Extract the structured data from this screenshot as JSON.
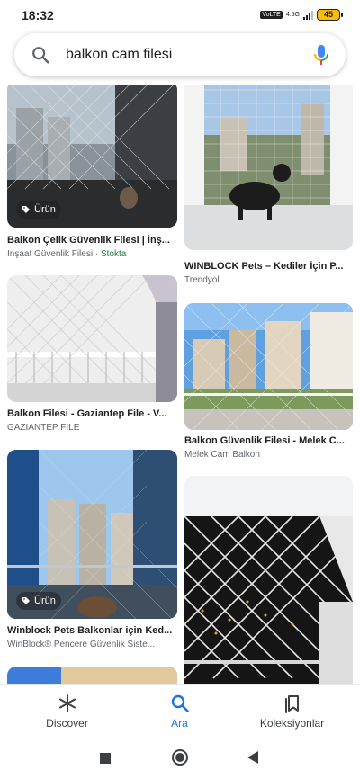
{
  "status": {
    "time": "18:32",
    "volte": "VoLTE",
    "network": "4.5G",
    "battery": "45"
  },
  "search": {
    "query": "balkon cam filesi"
  },
  "results": [
    {
      "title": "Balkon Çelik Güvenlik Filesi | İnş...",
      "source": "İnşaat Güvenlik Filesi",
      "separator": " · ",
      "stock": "Stokta",
      "chip": "Ürün"
    },
    {
      "title": "WINBLOCK Pets – Kediler İçin P...",
      "source": "Trendyol"
    },
    {
      "title": "Balkon Filesi - Gaziantep File - V...",
      "source": "GAZİANTEP FİLE"
    },
    {
      "title": "Balkon Güvenlik Filesi - Melek C...",
      "source": "Melek Cam Balkon"
    },
    {
      "title": "Winblock Pets Balkonlar için Ked...",
      "source": "WinBlock® Pencere Güvenlik Siste...",
      "chip": "Ürün"
    }
  ],
  "nav": {
    "discover": "Discover",
    "search": "Ara",
    "collections": "Koleksiyonlar"
  },
  "colors": {
    "accent": "#1a73e8",
    "stock": "#188038"
  }
}
